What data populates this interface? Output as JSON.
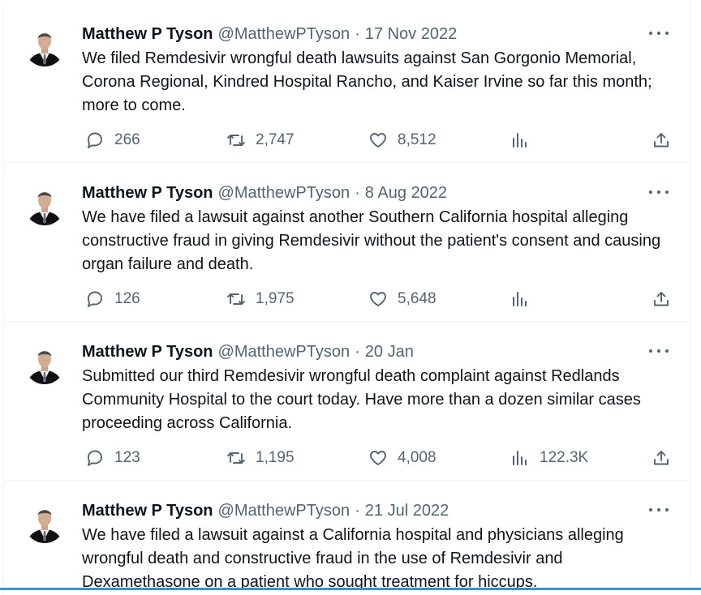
{
  "tweets": [
    {
      "name": "Matthew P Tyson",
      "handle": "@MatthewPTyson",
      "date": "17 Nov 2022",
      "text": "We filed Remdesivir wrongful death lawsuits against San Gorgonio Memorial, Corona Regional, Kindred Hospital Rancho, and Kaiser Irvine so far this month; more to come.",
      "replies": "266",
      "retweets": "2,747",
      "likes": "8,512",
      "views": ""
    },
    {
      "name": "Matthew P Tyson",
      "handle": "@MatthewPTyson",
      "date": "8 Aug 2022",
      "text": "We have filed a lawsuit against another Southern California hospital alleging constructive fraud in giving Remdesivir without the patient's consent and causing organ failure and death.",
      "replies": "126",
      "retweets": "1,975",
      "likes": "5,648",
      "views": ""
    },
    {
      "name": "Matthew P Tyson",
      "handle": "@MatthewPTyson",
      "date": "20 Jan",
      "text": "Submitted our third Remdesivir wrongful death complaint against Redlands Community Hospital to the court today.  Have more than a dozen similar cases proceeding across California.",
      "replies": "123",
      "retweets": "1,195",
      "likes": "4,008",
      "views": "122.3K"
    },
    {
      "name": "Matthew P Tyson",
      "handle": "@MatthewPTyson",
      "date": "21 Jul 2022",
      "text": "We have filed a lawsuit against a California hospital and physicians alleging wrongful death and constructive fraud in the use of Remdesivir and Dexamethasone on a patient who sought treatment for hiccups.",
      "replies": "",
      "retweets": "",
      "likes": "",
      "views": ""
    }
  ],
  "icons": {
    "reply": "reply-icon",
    "retweet": "retweet-icon",
    "like": "heart-icon",
    "views": "views-icon",
    "share": "share-icon",
    "more": "more-icon"
  },
  "colors": {
    "text": "#0f1419",
    "secondary": "#536471",
    "border": "#eff3f4"
  }
}
